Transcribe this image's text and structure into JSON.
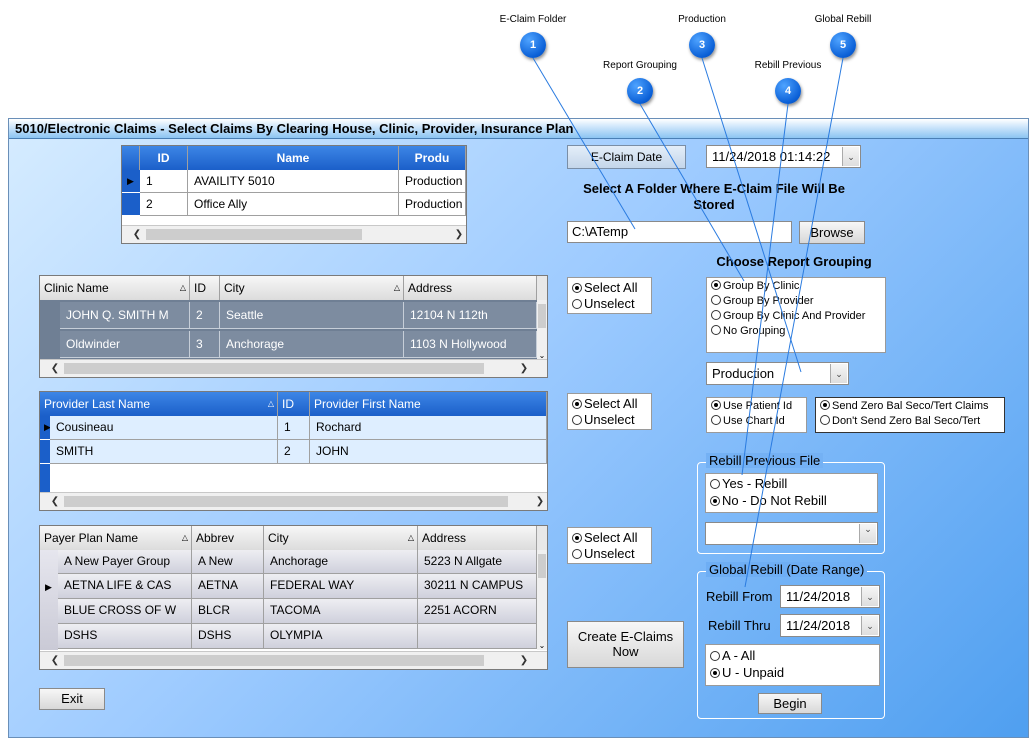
{
  "callouts": [
    {
      "num": "1",
      "label": "E-Claim Folder"
    },
    {
      "num": "2",
      "label": "Report Grouping"
    },
    {
      "num": "3",
      "label": "Production"
    },
    {
      "num": "4",
      "label": "Rebill Previous"
    },
    {
      "num": "5",
      "label": "Global Rebill"
    }
  ],
  "window": {
    "title": "5010/Electronic Claims - Select Claims By Clearing House, Clinic, Provider, Insurance Plan"
  },
  "clearinghouse": {
    "headers": [
      "ID",
      "Name",
      "Produ"
    ],
    "rows": [
      [
        "1",
        "AVAILITY 5010",
        "Production"
      ],
      [
        "2",
        "Office Ally",
        "Production"
      ]
    ]
  },
  "clinic": {
    "headers": [
      "Clinic Name",
      "ID",
      "City",
      "Address"
    ],
    "rows": [
      [
        "JOHN Q. SMITH M",
        "2",
        "Seattle",
        "12104 N 112th"
      ],
      [
        "Oldwinder",
        "3",
        "Anchorage",
        "1103 N Hollywood"
      ]
    ]
  },
  "provider": {
    "headers": [
      "Provider Last Name",
      "ID",
      "Provider First Name"
    ],
    "rows": [
      [
        "Cousineau",
        "1",
        "Rochard"
      ],
      [
        "SMITH",
        "2",
        "JOHN"
      ]
    ]
  },
  "payer": {
    "headers": [
      "Payer Plan Name",
      "Abbrev",
      "City",
      "Address"
    ],
    "rows": [
      [
        "A New Payer Group",
        "A New",
        "Anchorage",
        "5223 N Allgate"
      ],
      [
        "AETNA LIFE & CAS",
        "AETNA",
        "FEDERAL WAY",
        "30211 N CAMPUS"
      ],
      [
        "BLUE CROSS OF W",
        "BLCR",
        "TACOMA",
        "2251 ACORN"
      ],
      [
        "DSHS",
        "DSHS",
        "OLYMPIA",
        ""
      ]
    ]
  },
  "select_all": "Select All",
  "unselect": "Unselect",
  "eclaim_date": {
    "label": "E-Claim Date",
    "value": "11/24/2018 01:14:22"
  },
  "folder": {
    "heading": "Select A Folder Where E-Claim File Will Be Stored",
    "value": "C:\\ATemp",
    "browse": "Browse"
  },
  "grouping": {
    "heading": "Choose Report Grouping",
    "options": [
      "Group By Clinic",
      "Group By Provider",
      "Group By Clinic And Provider",
      "No Grouping"
    ],
    "selected": 0
  },
  "production_combo": "Production",
  "chart_id": {
    "options": [
      "Use Patient Id",
      "Use Chart Id"
    ]
  },
  "zero_bal": {
    "options": [
      "Send Zero Bal Seco/Tert Claims",
      "Don't Send Zero Bal Seco/Tert"
    ]
  },
  "rebill": {
    "title": "Rebill Previous File",
    "options": [
      "Yes - Rebill",
      "No - Do Not Rebill"
    ]
  },
  "global": {
    "title": "Global Rebill (Date Range)",
    "from_label": "Rebill From",
    "from": "11/24/2018",
    "thru_label": "Rebill Thru",
    "thru": "11/24/2018",
    "options": [
      "A - All",
      "U - Unpaid"
    ],
    "begin": "Begin"
  },
  "create": "Create E-Claims Now",
  "exit": "Exit",
  "colors": {
    "accent_blue": "#1b5fc9",
    "callout_blue": "#0a5fd6",
    "grey_row": "#6f7f94"
  }
}
